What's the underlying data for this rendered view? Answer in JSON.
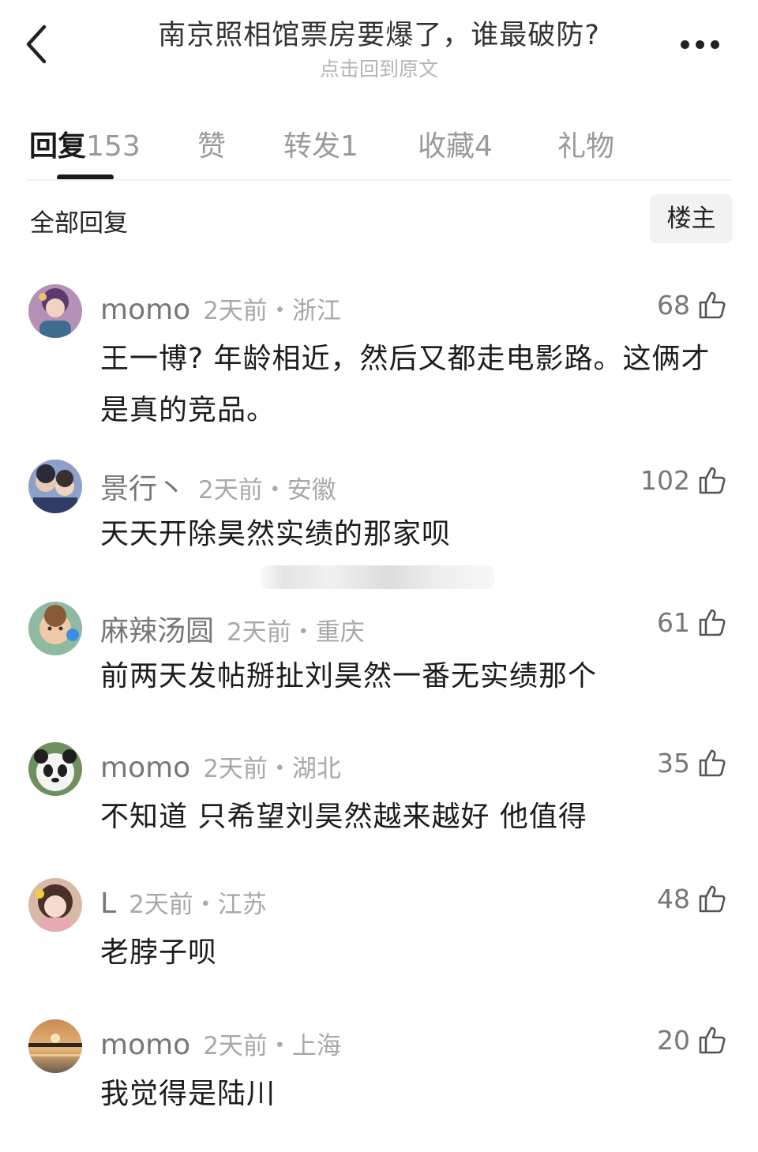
{
  "header": {
    "title": "南京照相馆票房要爆了，谁最破防?",
    "subtitle": "点击回到原文",
    "back_icon": "chevron-left-icon",
    "more_icon": "more-dots-icon"
  },
  "tabs": [
    {
      "label": "回复",
      "count": "153",
      "active": true
    },
    {
      "label": "赞",
      "count": ""
    },
    {
      "label": "转发",
      "count": "1"
    },
    {
      "label": "收藏",
      "count": "4"
    },
    {
      "label": "礼物",
      "count": ""
    }
  ],
  "filter": {
    "label": "全部回复",
    "owner_button": "楼主"
  },
  "comments": [
    {
      "name": "momo",
      "time": "2天前・浙江",
      "likes": "68",
      "text": "王一博? 年龄相近，然后又都走电影路。这俩才是真的竞品。"
    },
    {
      "name": "景行丶",
      "time": "2天前・安徽",
      "likes": "102",
      "text": "天天开除昊然实绩的那家呗"
    },
    {
      "name": "麻辣汤圆",
      "time": "2天前・重庆",
      "likes": "61",
      "text": "前两天发帖掰扯刘昊然一番无实绩那个"
    },
    {
      "name": "momo",
      "time": "2天前・湖北",
      "likes": "35",
      "text": "不知道 只希望刘昊然越来越好 他值得"
    },
    {
      "name": "L",
      "time": "2天前・江苏",
      "likes": "48",
      "text": "老脖子呗"
    },
    {
      "name": "momo",
      "time": "2天前・上海",
      "likes": "20",
      "text": "我觉得是陆川"
    }
  ],
  "colors": {
    "primary_text": "#1c1c1c",
    "secondary_text": "#777777",
    "muted_text": "#a8a8a8"
  }
}
